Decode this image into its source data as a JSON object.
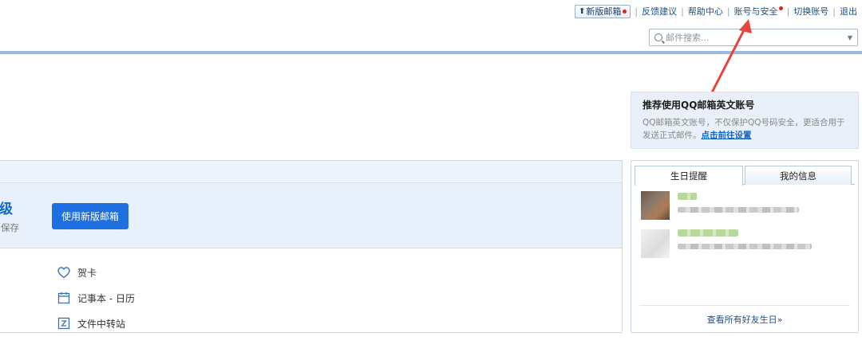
{
  "topnav": {
    "new_mail": "新版邮箱",
    "feedback": "反馈建议",
    "help": "帮助中心",
    "account_security": "账号与安全",
    "switch_account": "切换账号",
    "logout": "退出"
  },
  "search": {
    "placeholder": "邮件搜索..."
  },
  "recommend": {
    "title": "推荐使用QQ邮箱英文账号",
    "desc": "QQ邮箱英文账号，不仅保护QQ号码安全，更适合用于发送正式邮件。",
    "link": "点击前往设置"
  },
  "banner": {
    "headline_partial": "级",
    "sub_partial": "保存",
    "button": "使用新版邮箱"
  },
  "tools": [
    {
      "label": "贺卡",
      "icon": "heart-icon"
    },
    {
      "label": "记事本 - 日历",
      "icon": "calendar-icon"
    },
    {
      "label": "文件中转站",
      "icon": "file-transfer-icon"
    }
  ],
  "widget": {
    "tabs": [
      "生日提醒",
      "我的信息"
    ],
    "footer_link": "查看所有好友生日»"
  },
  "colors": {
    "accent": "#1e6fe0",
    "link": "#1f4f86",
    "annotation": "#e8443a",
    "badge": "#d9251c"
  }
}
